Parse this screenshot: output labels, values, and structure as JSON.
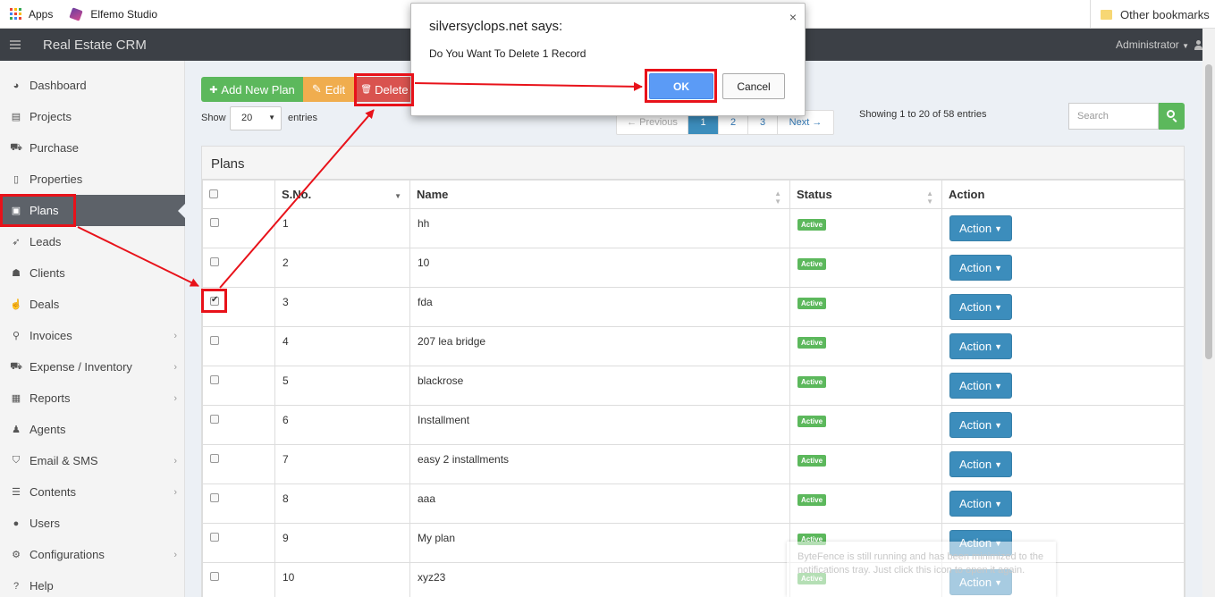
{
  "bookmarks": {
    "apps": "Apps",
    "elfemo": "Elfemo Studio",
    "other": "Other bookmarks"
  },
  "navbar": {
    "brand": "Real Estate CRM",
    "user": "Administrator"
  },
  "sidebar": {
    "items": [
      {
        "label": "Dashboard",
        "icon": "dashboard-icon",
        "glyph": "◕",
        "chevron": ""
      },
      {
        "label": "Projects",
        "icon": "projects-icon",
        "glyph": "▤",
        "chevron": ""
      },
      {
        "label": "Purchase",
        "icon": "cart-icon",
        "glyph": "⛟",
        "chevron": ""
      },
      {
        "label": "Properties",
        "icon": "building-icon",
        "glyph": "▯",
        "chevron": ""
      },
      {
        "label": "Plans",
        "icon": "briefcase-icon",
        "glyph": "▣",
        "chevron": ""
      },
      {
        "label": "Leads",
        "icon": "rocket-icon",
        "glyph": "➶",
        "chevron": ""
      },
      {
        "label": "Clients",
        "icon": "users-icon",
        "glyph": "☗",
        "chevron": ""
      },
      {
        "label": "Deals",
        "icon": "thumbs-up-icon",
        "glyph": "☝",
        "chevron": ""
      },
      {
        "label": "Invoices",
        "icon": "thumbtack-icon",
        "glyph": "⚲",
        "chevron": "›"
      },
      {
        "label": "Expense / Inventory",
        "icon": "cart-icon",
        "glyph": "⛟",
        "chevron": "›"
      },
      {
        "label": "Reports",
        "icon": "table-icon",
        "glyph": "▦",
        "chevron": "›"
      },
      {
        "label": "Agents",
        "icon": "agent-icon",
        "glyph": "♟",
        "chevron": ""
      },
      {
        "label": "Email & SMS",
        "icon": "shield-icon",
        "glyph": "⛉",
        "chevron": "›"
      },
      {
        "label": "Contents",
        "icon": "list-icon",
        "glyph": "☰",
        "chevron": "›"
      },
      {
        "label": "Users",
        "icon": "user-icon",
        "glyph": "●",
        "chevron": ""
      },
      {
        "label": "Configurations",
        "icon": "gears-icon",
        "glyph": "⚙",
        "chevron": "›"
      },
      {
        "label": "Help",
        "icon": "help-icon",
        "glyph": "?",
        "chevron": ""
      }
    ],
    "active_index": 4
  },
  "toolbar": {
    "add_label": "Add New Plan",
    "edit_label": "Edit",
    "delete_label": "Delete",
    "add_glyph": "✚",
    "edit_glyph": "✎",
    "delete_glyph": "🗑"
  },
  "length": {
    "show": "Show",
    "value": "20",
    "entries": "entries"
  },
  "pagination": {
    "prev": "← Previous",
    "pages": [
      "1",
      "2",
      "3"
    ],
    "next": "Next →",
    "current": "1"
  },
  "info": "Showing 1 to 20 of 58 entries",
  "search": {
    "placeholder": "Search"
  },
  "panel": {
    "title": "Plans"
  },
  "table": {
    "headers": {
      "sno": "S.No.",
      "name": "Name",
      "status": "Status",
      "action": "Action"
    },
    "rows": [
      {
        "sno": "1",
        "name": "hh",
        "status": "Active",
        "checked": false
      },
      {
        "sno": "2",
        "name": "10",
        "status": "Active",
        "checked": false
      },
      {
        "sno": "3",
        "name": "fda",
        "status": "Active",
        "checked": true
      },
      {
        "sno": "4",
        "name": "207 lea bridge",
        "status": "Active",
        "checked": false
      },
      {
        "sno": "5",
        "name": "blackrose",
        "status": "Active",
        "checked": false
      },
      {
        "sno": "6",
        "name": "Installment",
        "status": "Active",
        "checked": false
      },
      {
        "sno": "7",
        "name": "easy 2 installments",
        "status": "Active",
        "checked": false
      },
      {
        "sno": "8",
        "name": "aaa",
        "status": "Active",
        "checked": false
      },
      {
        "sno": "9",
        "name": "My plan",
        "status": "Active",
        "checked": false
      },
      {
        "sno": "10",
        "name": "xyz23",
        "status": "Active",
        "checked": false
      }
    ],
    "action_label": "Action"
  },
  "dialog": {
    "title": "silversyclops.net says:",
    "message": "Do You Want To Delete 1 Record",
    "ok": "OK",
    "cancel": "Cancel",
    "close": "×"
  },
  "notification": {
    "text": "ByteFence is still running and has been minimized to the notifications tray. Just click this icon to open it again."
  },
  "colors": {
    "highlight": "#e8121a",
    "accent": "#3c8dbc",
    "success": "#5cb85c"
  }
}
